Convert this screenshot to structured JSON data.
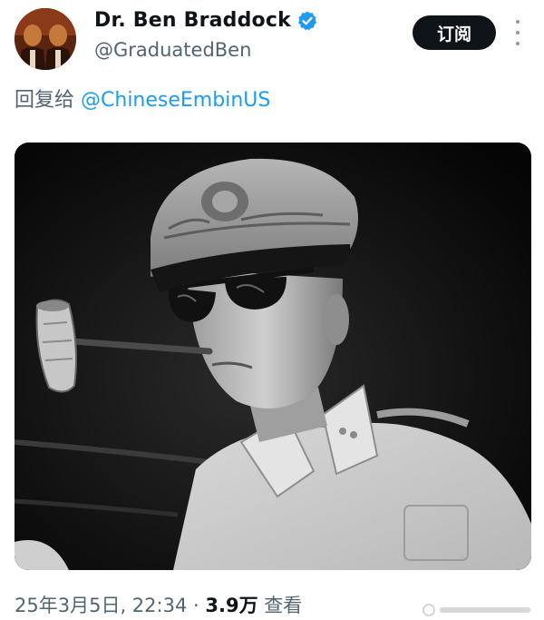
{
  "tweet": {
    "display_name": "Dr. Ben Braddock",
    "handle": "@GraduatedBen",
    "verified": true,
    "subscribe_label": "订阅",
    "reply_prefix": "回复给",
    "reply_mention": "@ChineseEmbinUS",
    "timestamp": "25年3月5日, 22:34",
    "separator": "·",
    "views_count": "3.9万",
    "views_label": "查看"
  },
  "icons": {
    "verified": "verified-badge-icon",
    "more": "more-options-icon"
  },
  "colors": {
    "link": "#1d9bf0",
    "secondary_text": "#536471",
    "button_bg": "#0f1419",
    "verified": "#1d9bf0"
  }
}
